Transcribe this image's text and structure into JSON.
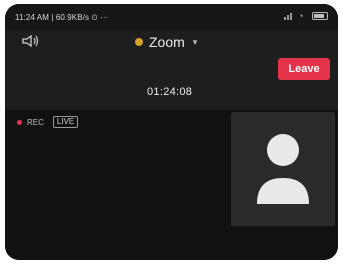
{
  "status_bar": {
    "left_text": "11:24 AM | 60.9KB/s ⏲ ···",
    "battery_icon": "battery-icon",
    "wifi_icon": "wifi-icon",
    "signal_icon": "signal-icon"
  },
  "header": {
    "speaker_icon": "speaker-icon",
    "title": "Zoom",
    "title_icon": "shield-icon",
    "dropdown_icon": "chevron-down-icon",
    "timer": "01:24:08",
    "leave_label": "Leave"
  },
  "meeting": {
    "rec_label": "REC",
    "live_label": "LIVE"
  },
  "colors": {
    "leave": "#e5334a",
    "accent_shield": "#d8a12a"
  }
}
